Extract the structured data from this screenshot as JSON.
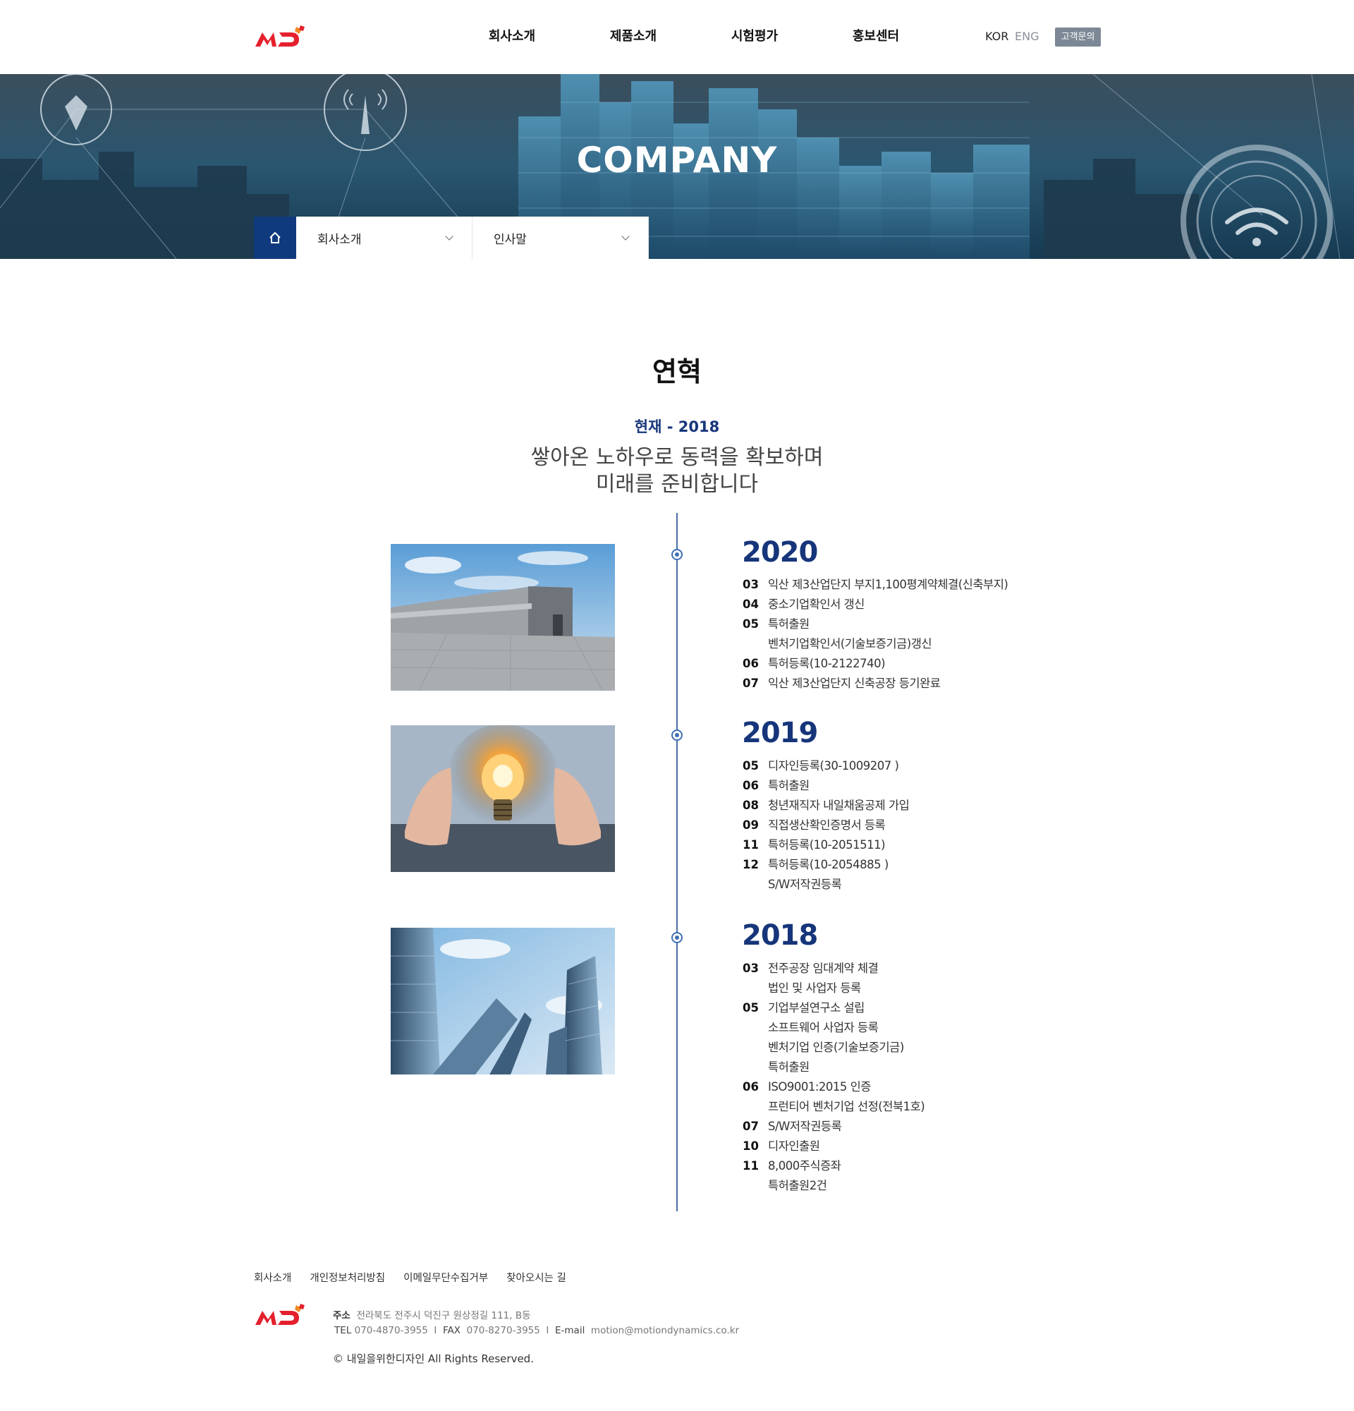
{
  "header": {
    "nav": [
      "회사소개",
      "제품소개",
      "시험평가",
      "홍보센터"
    ],
    "lang_kor": "KOR",
    "lang_eng": "ENG",
    "cs_button": "고객문의"
  },
  "hero": {
    "title": "COMPANY",
    "breadcrumb": [
      "회사소개",
      "인사말"
    ]
  },
  "history": {
    "title": "연혁",
    "period": "현재 - 2018",
    "slogan_line1": "쌓아온 노하우로 동력을 확보하며",
    "slogan_line2": "미래를 준비합니다",
    "years": [
      {
        "year": "2020",
        "image": "factory-photo",
        "events": [
          {
            "month": "03",
            "text": "익산 제3산업단지 부지1,100평계약체결(신축부지)"
          },
          {
            "month": "04",
            "text": "중소기업확인서 갱신"
          },
          {
            "month": "05",
            "text": "특허출원"
          },
          {
            "month": "",
            "text": "벤처기업확인서(기술보증기금)갱신"
          },
          {
            "month": "06",
            "text": "특허등록(10-2122740)"
          },
          {
            "month": "07",
            "text": "익산 제3산업단지 신축공장 등기완료"
          }
        ]
      },
      {
        "year": "2019",
        "image": "lightbulb-photo",
        "events": [
          {
            "month": "05",
            "text": "디자인등록(30-1009207 )"
          },
          {
            "month": "06",
            "text": "특허출원"
          },
          {
            "month": "08",
            "text": "청년재직자 내일채움공제 가입"
          },
          {
            "month": "09",
            "text": "직접생산확인증명서 등록"
          },
          {
            "month": "11",
            "text": "특허등록(10-2051511)"
          },
          {
            "month": "12",
            "text": "특허등록(10-2054885 )"
          },
          {
            "month": "",
            "text": "S/W저작권등록"
          }
        ]
      },
      {
        "year": "2018",
        "image": "skyscraper-photo",
        "events": [
          {
            "month": "03",
            "text": "전주공장 임대계약 체결"
          },
          {
            "month": "",
            "text": "법인 및 사업자 등록"
          },
          {
            "month": "05",
            "text": "기업부설연구소 설립"
          },
          {
            "month": "",
            "text": "소프트웨어 사업자 등록"
          },
          {
            "month": "",
            "text": "벤처기업 인증(기술보증기금)"
          },
          {
            "month": "",
            "text": "특허출원"
          },
          {
            "month": "06",
            "text": "ISO9001:2015 인증"
          },
          {
            "month": "",
            "text": "프런티어 벤처기업 선정(전북1호)"
          },
          {
            "month": "07",
            "text": "S/W저작권등록"
          },
          {
            "month": "10",
            "text": "디자인출원"
          },
          {
            "month": "11",
            "text": "8,000주식증좌"
          },
          {
            "month": "",
            "text": "특허출원2건"
          }
        ]
      }
    ]
  },
  "footer": {
    "links": [
      "회사소개",
      "개인정보처리방침",
      "이메일무단수집거부",
      "찾아오시는 길"
    ],
    "addr_label": "주소",
    "addr": "전라북도 전주시 덕진구 원상정길 111, B동",
    "tel_label": "TEL",
    "tel": "070-4870-3955",
    "fax_label": "FAX",
    "fax": "070-8270-3955",
    "email_label": "E-mail",
    "email": "motion@motiondynamics.co.kr",
    "copyright": "© 내일을위한디자인  All Rights Reserved."
  },
  "colors": {
    "brand_red": "#e5202d",
    "brand_navy": "#16357a",
    "home_bg": "#0f3a7e",
    "cs_btn_bg": "#7d8896"
  }
}
